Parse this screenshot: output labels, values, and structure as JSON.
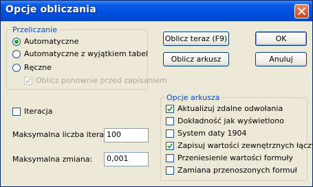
{
  "window": {
    "title": "Opcje obliczania"
  },
  "recalc": {
    "legend": "Przeliczanie",
    "options": [
      {
        "label": "Automatyczne",
        "selected": true
      },
      {
        "label": "Automatyczne z wyjątkiem tabel",
        "selected": false
      },
      {
        "label": "Ręczne",
        "selected": false
      }
    ],
    "recalc_before_save": {
      "label": "Oblicz ponownie przed zapisaniem",
      "checked": true,
      "enabled": false
    }
  },
  "buttons": {
    "calc_now": "Oblicz teraz (F9)",
    "calc_sheet": "Oblicz arkusz",
    "ok": "OK",
    "cancel": "Anuluj"
  },
  "iteration": {
    "label": "Iteracja",
    "checked": false,
    "max_iterations_label": "Maksymalna liczba iteracji:",
    "max_iterations_value": "100",
    "max_change_label": "Maksymalna zmiana:",
    "max_change_value": "0,001"
  },
  "sheet_options": {
    "legend": "Opcje arkusza",
    "items": [
      {
        "label": "Aktualizuj zdalne odwołania",
        "checked": true
      },
      {
        "label": "Dokładność jak wyświetlono",
        "checked": false
      },
      {
        "label": "System daty 1904",
        "checked": false
      },
      {
        "label": "Zapisuj wartości zewnętrznych łączy",
        "checked": true
      },
      {
        "label": "Przeniesienie wartości formuły",
        "checked": false
      },
      {
        "label": "Zamiana przenoszonych formuł",
        "checked": false
      }
    ]
  },
  "colors": {
    "titlebar": "#0054e3",
    "legend": "#0046d5",
    "radio_dot": "#21a121",
    "check": "#21a121"
  }
}
